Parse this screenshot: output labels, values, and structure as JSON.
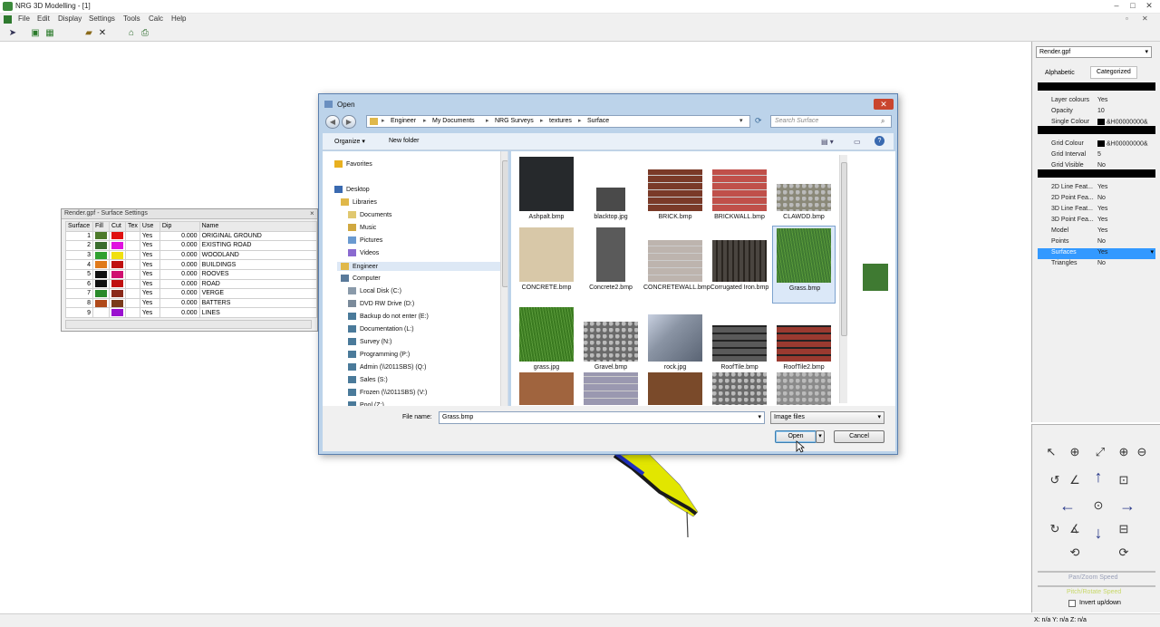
{
  "app": {
    "title": "NRG 3D Modelling - [1]"
  },
  "menu": [
    "File",
    "Edit",
    "Display",
    "Settings",
    "Tools",
    "Calc",
    "Help"
  ],
  "render_panel": {
    "title": "Render.gpf - Surface Settings",
    "headers": [
      "Surface",
      "Fill",
      "Cut",
      "Tex",
      "Use",
      "Dip",
      "Name"
    ],
    "rows": [
      {
        "num": "1",
        "fill": "#4d7a2a",
        "cut": "#e01010",
        "use": "Yes",
        "dip": "0.000",
        "name": "ORIGINAL GROUND"
      },
      {
        "num": "2",
        "fill": "#3b6e2e",
        "cut": "#e010e0",
        "use": "Yes",
        "dip": "0.000",
        "name": "EXISTING ROAD"
      },
      {
        "num": "3",
        "fill": "#30a030",
        "cut": "#f0e010",
        "use": "Yes",
        "dip": "0.000",
        "name": "WOODLAND"
      },
      {
        "num": "4",
        "fill": "#e07a1a",
        "cut": "#c01010",
        "use": "Yes",
        "dip": "0.000",
        "name": "BUILDINGS"
      },
      {
        "num": "5",
        "fill": "#111111",
        "cut": "#d01070",
        "use": "Yes",
        "dip": "0.000",
        "name": "ROOVES"
      },
      {
        "num": "6",
        "fill": "#111111",
        "cut": "#c01010",
        "use": "Yes",
        "dip": "0.000",
        "name": "ROAD"
      },
      {
        "num": "7",
        "fill": "#2a8a2a",
        "cut": "#8a2a1a",
        "use": "Yes",
        "dip": "0.000",
        "name": "VERGE"
      },
      {
        "num": "8",
        "fill": "#b04a1a",
        "cut": "#7a3a1a",
        "use": "Yes",
        "dip": "0.000",
        "name": "BATTERS"
      },
      {
        "num": "9",
        "fill": "#ffffff",
        "cut": "#9a10d0",
        "use": "Yes",
        "dip": "0.000",
        "name": "LINES"
      }
    ]
  },
  "props": {
    "combo": "Render.gpf",
    "tabs": [
      "Alphabetic",
      "Categorized"
    ],
    "rows": [
      {
        "k": "Layer colours",
        "v": "Yes"
      },
      {
        "k": "Opacity",
        "v": "10"
      },
      {
        "k": "Single Colour",
        "v": "&H00000000&"
      },
      {
        "k": "Grid Colour",
        "v": "&H00000000&"
      },
      {
        "k": "Grid Interval",
        "v": "5"
      },
      {
        "k": "Grid Visible",
        "v": "No"
      },
      {
        "k": "2D Line Feat...",
        "v": "Yes"
      },
      {
        "k": "2D Point Fea...",
        "v": "No"
      },
      {
        "k": "3D Line Feat...",
        "v": "Yes"
      },
      {
        "k": "3D Point Fea...",
        "v": "Yes"
      },
      {
        "k": "Model",
        "v": "Yes"
      },
      {
        "k": "Points",
        "v": "No"
      },
      {
        "k": "Surfaces",
        "v": "Yes"
      },
      {
        "k": "Triangles",
        "v": "No"
      }
    ]
  },
  "nav_panel": {
    "pan_speed": "Pan/Zoom Speed",
    "pitch_speed": "Pitch/Rotate Speed",
    "invert": "Invert up/down"
  },
  "status": {
    "coords": "X: n/a Y: n/a Z: n/a"
  },
  "dialog": {
    "title": "Open",
    "breadcrumb": [
      "Engineer",
      "My Documents",
      "NRG Surveys",
      "textures",
      "Surface"
    ],
    "search_placeholder": "Search Surface",
    "organize": "Organize",
    "new_folder": "New folder",
    "nav": [
      {
        "label": "Favorites",
        "type": "star"
      },
      {
        "label": "Desktop",
        "type": "desktop"
      },
      {
        "label": "Libraries",
        "type": "lib"
      },
      {
        "label": "Documents",
        "type": "doc"
      },
      {
        "label": "Music",
        "type": "music"
      },
      {
        "label": "Pictures",
        "type": "pic"
      },
      {
        "label": "Videos",
        "type": "vid"
      },
      {
        "label": "Engineer",
        "type": "user"
      },
      {
        "label": "Computer",
        "type": "computer"
      },
      {
        "label": "Local Disk (C:)",
        "type": "disk"
      },
      {
        "label": "DVD RW Drive (D:)",
        "type": "dvd"
      },
      {
        "label": "Backup do not enter (E:)",
        "type": "net"
      },
      {
        "label": "Documentation (L:)",
        "type": "net"
      },
      {
        "label": "Survey (N:)",
        "type": "net"
      },
      {
        "label": "Programming (P:)",
        "type": "net"
      },
      {
        "label": "Admin (\\\\2011SBS) (Q:)",
        "type": "net"
      },
      {
        "label": "Sales (S:)",
        "type": "net"
      },
      {
        "label": "Frozen (\\\\2011SBS) (V:)",
        "type": "net"
      },
      {
        "label": "Pool (Z:)",
        "type": "net"
      }
    ],
    "files": [
      {
        "label": "Ashpalt.bmp",
        "color": "#26292c",
        "pattern": "dark"
      },
      {
        "label": "blacktop.jpg",
        "color": "#4a4a4a",
        "pattern": "small"
      },
      {
        "label": "BRICK.bmp",
        "color": "#7a3a28",
        "pattern": "brick"
      },
      {
        "label": "BRICKWALL.bmp",
        "color": "#c0504a",
        "pattern": "brick"
      },
      {
        "label": "CLAWDD.bmp",
        "color": "#8a8878",
        "pattern": "stone"
      },
      {
        "label": "CONCRETE.bmp",
        "color": "#d8c8a8",
        "pattern": "flat"
      },
      {
        "label": "Concrete2.bmp",
        "color": "#5a5a5a",
        "pattern": "tall"
      },
      {
        "label": "CONCRETEWALL.bmp",
        "color": "#bdb4ae",
        "pattern": "brick"
      },
      {
        "label": "Corrugated Iron.bmp",
        "color": "#4a4540",
        "pattern": "stripes"
      },
      {
        "label": "Grass.bmp",
        "color": "#3f7a32",
        "pattern": "grass"
      },
      {
        "label": "grass.jpg",
        "color": "#3a7a20",
        "pattern": "grass"
      },
      {
        "label": "Gravel.bmp",
        "color": "#6a6a6a",
        "pattern": "gravel"
      },
      {
        "label": "rock.jpg",
        "color": "#8a94a4",
        "pattern": "rock"
      },
      {
        "label": "RoofTile.bmp",
        "color": "#5a5a5a",
        "pattern": "tiles"
      },
      {
        "label": "RoofTile2.bmp",
        "color": "#9a3a30",
        "pattern": "tiles"
      },
      {
        "label": "",
        "color": "#a0643e",
        "pattern": "flat"
      },
      {
        "label": "",
        "color": "#9a98b0",
        "pattern": "brick"
      },
      {
        "label": "",
        "color": "#7a4a2a",
        "pattern": "flat"
      },
      {
        "label": "",
        "color": "#6a6a6a",
        "pattern": "stone"
      },
      {
        "label": "",
        "color": "#8a8a8a",
        "pattern": "gravel"
      }
    ],
    "filename_label": "File name:",
    "filename_value": "Grass.bmp",
    "filetype": "Image files",
    "open": "Open",
    "cancel": "Cancel"
  }
}
